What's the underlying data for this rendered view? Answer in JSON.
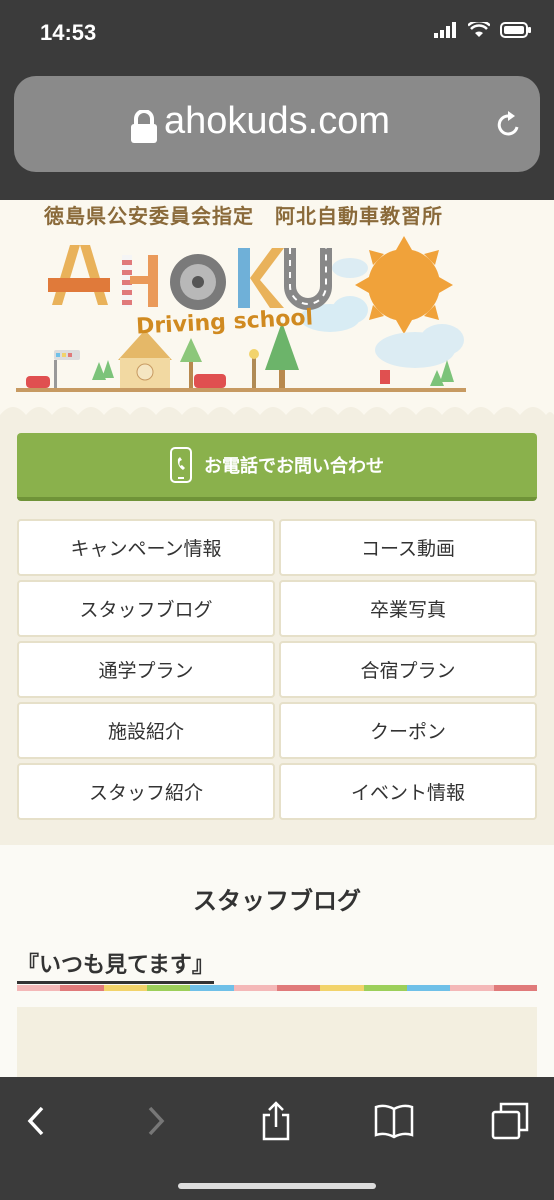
{
  "status": {
    "time": "14:53"
  },
  "browser": {
    "url": "ahokuds.com"
  },
  "header": {
    "subtitle": "徳島県公安委員会指定　阿北自動車教習所",
    "logo": "AHOKU",
    "logo_sub": "Driving school"
  },
  "contact": {
    "label": "お電話でお問い合わせ"
  },
  "menu": {
    "items": [
      {
        "label": "キャンペーン情報"
      },
      {
        "label": "コース動画"
      },
      {
        "label": "スタッフブログ"
      },
      {
        "label": "卒業写真"
      },
      {
        "label": "通学プラン"
      },
      {
        "label": "合宿プラン"
      },
      {
        "label": "施設紹介"
      },
      {
        "label": "クーポン"
      },
      {
        "label": "スタッフ紹介"
      },
      {
        "label": "イベント情報"
      }
    ]
  },
  "blog": {
    "section_title": "スタッフブログ",
    "post_title": "『いつも見てます』"
  },
  "colors": {
    "accent_green": "#8ab14c",
    "stripe": [
      "#f4b8b8",
      "#e07a7a",
      "#f2d36b",
      "#9ccf5a",
      "#6fc0e8"
    ]
  }
}
